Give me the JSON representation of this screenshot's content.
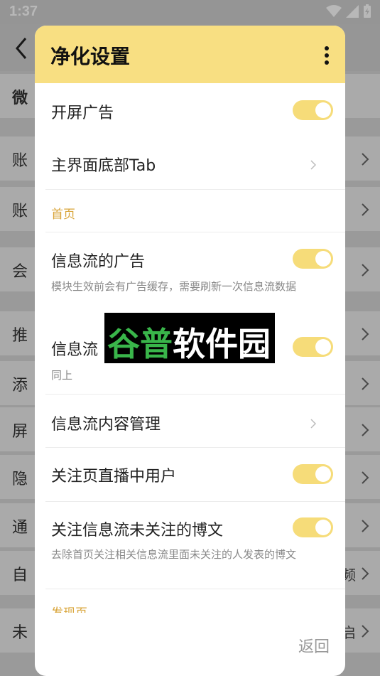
{
  "status_bar": {
    "time": "1:37"
  },
  "background": {
    "items": [
      {
        "label": "微",
        "chevron": false
      },
      {
        "label": "账",
        "chevron": true
      },
      {
        "label": "账",
        "chevron": true
      },
      {
        "label": "会",
        "chevron": true
      },
      {
        "label": "推",
        "chevron": true
      },
      {
        "label": "添",
        "chevron": true
      },
      {
        "label": "屏",
        "chevron": true
      },
      {
        "label": "隐",
        "chevron": true
      },
      {
        "label": "通",
        "chevron": true
      },
      {
        "label": "自",
        "right": "频",
        "chevron": true
      },
      {
        "label": "未",
        "right": "启",
        "chevron": true
      }
    ]
  },
  "dialog": {
    "title": "净化设置",
    "rows": {
      "splash_ad": {
        "label": "开屏广告",
        "toggle": true
      },
      "main_bottom_tab": {
        "label": "主界面底部Tab"
      },
      "section_home": "首页",
      "feed_ad": {
        "label": "信息流的广告",
        "desc": "模块生效前会有广告缓存，需要刷新一次信息流数据",
        "toggle": true
      },
      "feed_second": {
        "label": "信息流",
        "desc": "同上",
        "toggle": true
      },
      "feed_content_manage": {
        "label": "信息流内容管理"
      },
      "follow_live_users": {
        "label": "关注页直播中用户",
        "toggle": true
      },
      "follow_unfollowed_posts": {
        "label": "关注信息流未关注的博文",
        "desc": "去除首页关注相关信息流里面未关注的人发表的博文",
        "toggle": true
      },
      "section_discover": "发现页"
    },
    "back_button": "返回"
  },
  "watermark": {
    "part1": "谷普",
    "part2": "软件园"
  },
  "colors": {
    "accent": "#f8df82",
    "toggle_on": "#f6dc79",
    "section": "#d9a53a"
  }
}
